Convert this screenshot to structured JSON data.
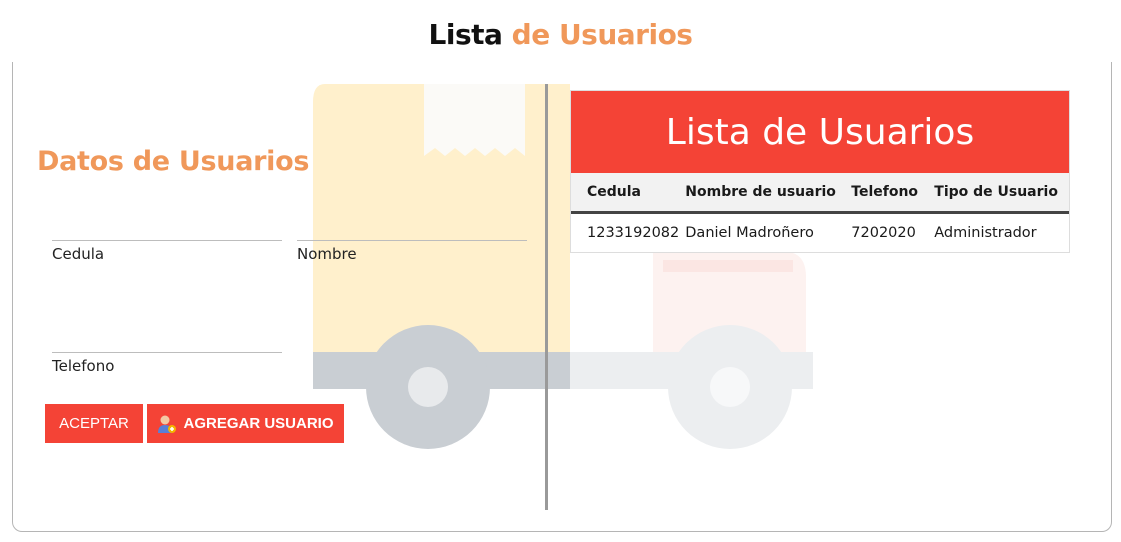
{
  "header": {
    "title_part1": "Lista",
    "title_part2": "de Usuarios"
  },
  "form": {
    "title": "Datos de Usuarios",
    "fields": {
      "cedula": {
        "label": "Cedula",
        "value": ""
      },
      "nombre": {
        "label": "Nombre",
        "value": ""
      },
      "telefono": {
        "label": "Telefono",
        "value": ""
      }
    },
    "accept_label": "ACEPTAR",
    "add_user_label": "AGREGAR USUARIO"
  },
  "table": {
    "title": "Lista de Usuarios",
    "columns": [
      "Cedula",
      "Nombre de usuario",
      "Telefono",
      "Tipo de Usuario"
    ],
    "rows": [
      [
        "1233192082",
        "Daniel Madroñero",
        "7202020",
        "Administrador"
      ]
    ]
  },
  "colors": {
    "accent": "#f44336",
    "title_orange": "#f0985a"
  },
  "icons": {
    "add_user": "user-add-icon",
    "background": "truck-illustration"
  }
}
